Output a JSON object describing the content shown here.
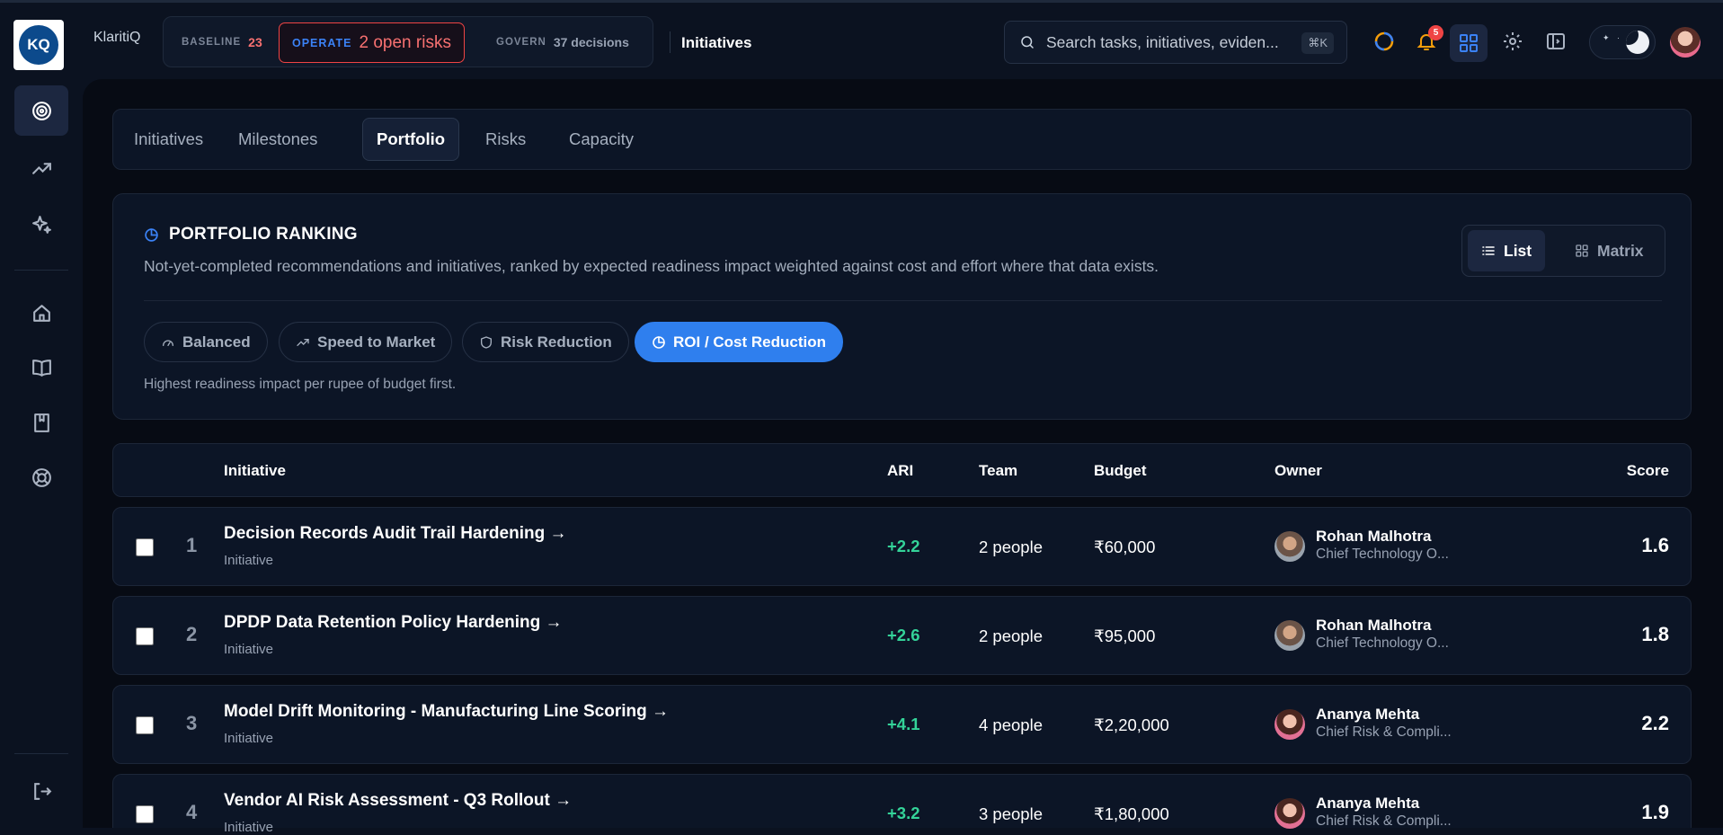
{
  "brand": {
    "name": "KlaritiQ",
    "logo_text": "KQ"
  },
  "phases": {
    "baseline": {
      "label": "BASELINE",
      "value": "23"
    },
    "operate": {
      "label": "OPERATE",
      "value": "2 open risks"
    },
    "govern": {
      "label": "GOVERN",
      "value": "37 decisions"
    }
  },
  "page_name": "Initiatives",
  "search": {
    "placeholder": "Search tasks, initiatives, eviden...",
    "shortcut": "⌘K"
  },
  "notifications": {
    "count": "5"
  },
  "tabs": [
    {
      "label": "Initiatives"
    },
    {
      "label": "Milestones"
    },
    {
      "label": "Portfolio",
      "active": true
    },
    {
      "label": "Risks"
    },
    {
      "label": "Capacity"
    }
  ],
  "ranking": {
    "title": "PORTFOLIO RANKING",
    "description": "Not-yet-completed recommendations and initiatives, ranked by expected readiness impact weighted against cost and effort where that data exists.",
    "view": {
      "list": "List",
      "matrix": "Matrix",
      "selected": "List"
    },
    "strategies": [
      {
        "label": "Balanced"
      },
      {
        "label": "Speed to Market"
      },
      {
        "label": "Risk Reduction"
      },
      {
        "label": "ROI / Cost Reduction",
        "active": true
      }
    ],
    "strategy_note": "Highest readiness impact per rupee of budget first."
  },
  "table": {
    "columns": {
      "initiative": "Initiative",
      "ari": "ARI",
      "team": "Team",
      "budget": "Budget",
      "owner": "Owner",
      "score": "Score"
    },
    "rows": [
      {
        "rank": "1",
        "title": "Decision Records Audit Trail Hardening →",
        "type": "Initiative",
        "ari": "+2.2",
        "team": "2 people",
        "budget": "₹60,000",
        "owner": "Rohan Malhotra",
        "role": "Chief Technology O...",
        "score": "1.6"
      },
      {
        "rank": "2",
        "title": "DPDP Data Retention Policy Hardening →",
        "type": "Initiative",
        "ari": "+2.6",
        "team": "2 people",
        "budget": "₹95,000",
        "owner": "Rohan Malhotra",
        "role": "Chief Technology O...",
        "score": "1.8"
      },
      {
        "rank": "3",
        "title": "Model Drift Monitoring - Manufacturing Line Scoring →",
        "type": "Initiative",
        "ari": "+4.1",
        "team": "4 people",
        "budget": "₹2,20,000",
        "owner": "Ananya Mehta",
        "role": "Chief Risk & Compli...",
        "score": "2.2"
      },
      {
        "rank": "4",
        "title": "Vendor AI Risk Assessment - Q3 Rollout →",
        "type": "Initiative",
        "ari": "+3.2",
        "team": "3 people",
        "budget": "₹1,80,000",
        "owner": "Ananya Mehta",
        "role": "Chief Risk & Compli...",
        "score": "1.9"
      }
    ]
  }
}
